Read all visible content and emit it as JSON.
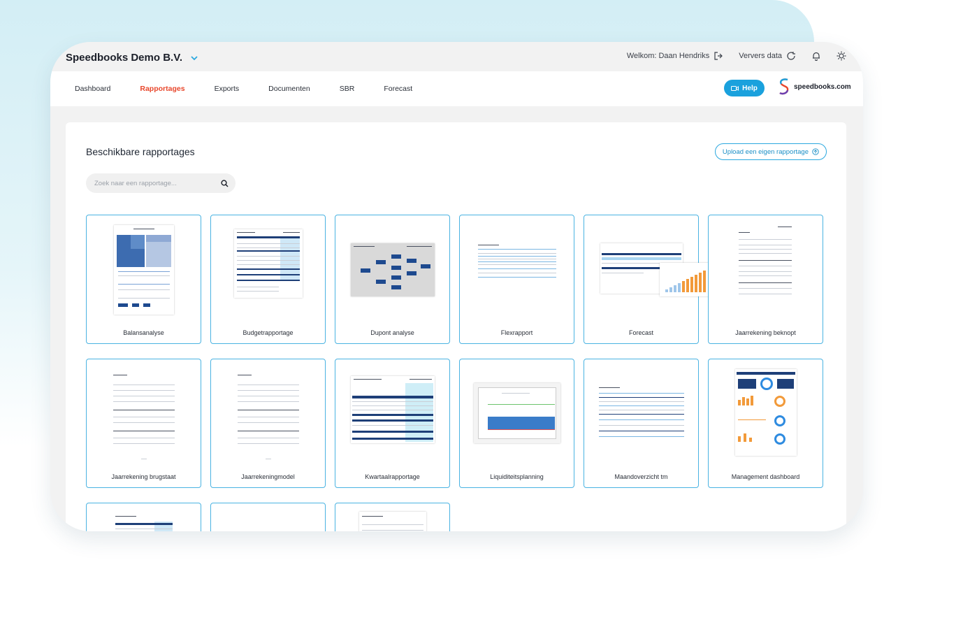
{
  "header": {
    "company": "Speedbooks Demo B.V.",
    "welcome": "Welkom: Daan Hendriks",
    "refresh": "Ververs data"
  },
  "nav": {
    "items": [
      "Dashboard",
      "Rapportages",
      "Exports",
      "Documenten",
      "SBR",
      "Forecast"
    ],
    "active": "Rapportages",
    "help": "Help",
    "logo": "speedbooks.com"
  },
  "colors": {
    "accent": "#1aa1dd",
    "active_nav": "#e8472c",
    "card_border": "#4ab3e2"
  },
  "main": {
    "title": "Beschikbare rapportages",
    "upload": "Upload een eigen rapportage",
    "search_placeholder": "Zoek naar een rapportage...",
    "reports": [
      {
        "label": "Balansanalyse"
      },
      {
        "label": "Budgetrapportage"
      },
      {
        "label": "Dupont analyse"
      },
      {
        "label": "Flexrapport"
      },
      {
        "label": "Forecast"
      },
      {
        "label": "Jaarrekening beknopt"
      },
      {
        "label": "Jaarrekening brugstaat"
      },
      {
        "label": "Jaarrekeningmodel"
      },
      {
        "label": "Kwartaalrapportage"
      },
      {
        "label": "Liquiditeitsplanning"
      },
      {
        "label": "Maandoverzicht tm"
      },
      {
        "label": "Management dashboard"
      },
      {
        "label": ""
      },
      {
        "label": ""
      },
      {
        "label": ""
      }
    ]
  }
}
